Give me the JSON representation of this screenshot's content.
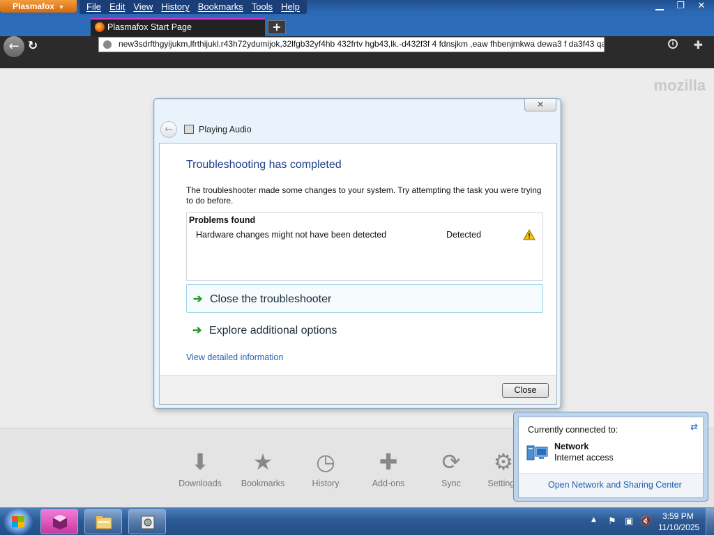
{
  "browser": {
    "app_button": "Plasmafox",
    "menu": [
      "File",
      "Edit",
      "View",
      "History",
      "Bookmarks",
      "Tools",
      "Help"
    ],
    "tab_title": "Plasmafox Start Page",
    "new_tab": "+",
    "url": "new3sdrfthgyijukm,lfrthijukl.r43h72ydumijok,32lfgb32yf4hb 432frtv hgb43,lk.-d432f3f 4 fdnsjkm ,eaw fhbenjmkwa dewa3 f da3f43 qa",
    "brand": "mozilla",
    "launcher": [
      "Downloads",
      "Bookmarks",
      "History",
      "Add-ons",
      "Sync",
      "Settings"
    ]
  },
  "dialog": {
    "title": "Playing Audio",
    "heading": "Troubleshooting has completed",
    "description": "The troubleshooter made some changes to your system. Try attempting the task you were trying to do before.",
    "problems_header": "Problems found",
    "problems": [
      {
        "name": "Hardware changes might not have been detected",
        "status": "Detected"
      }
    ],
    "close_troubleshooter": "Close the troubleshooter",
    "explore_options": "Explore additional options",
    "view_details": "View detailed information",
    "close_button": "Close"
  },
  "network_flyout": {
    "caption": "Currently connected to:",
    "network_name": "Network",
    "network_status": "Internet access",
    "link": "Open Network and Sharing Center"
  },
  "taskbar": {
    "time": "3:59 PM",
    "date": "11/10/2025"
  },
  "colors": {
    "accent_blue": "#1f3f8a",
    "link_blue": "#1f5fb0",
    "tab_highlight": "#d63ad1",
    "app_button_orange": "#e07a1a"
  }
}
